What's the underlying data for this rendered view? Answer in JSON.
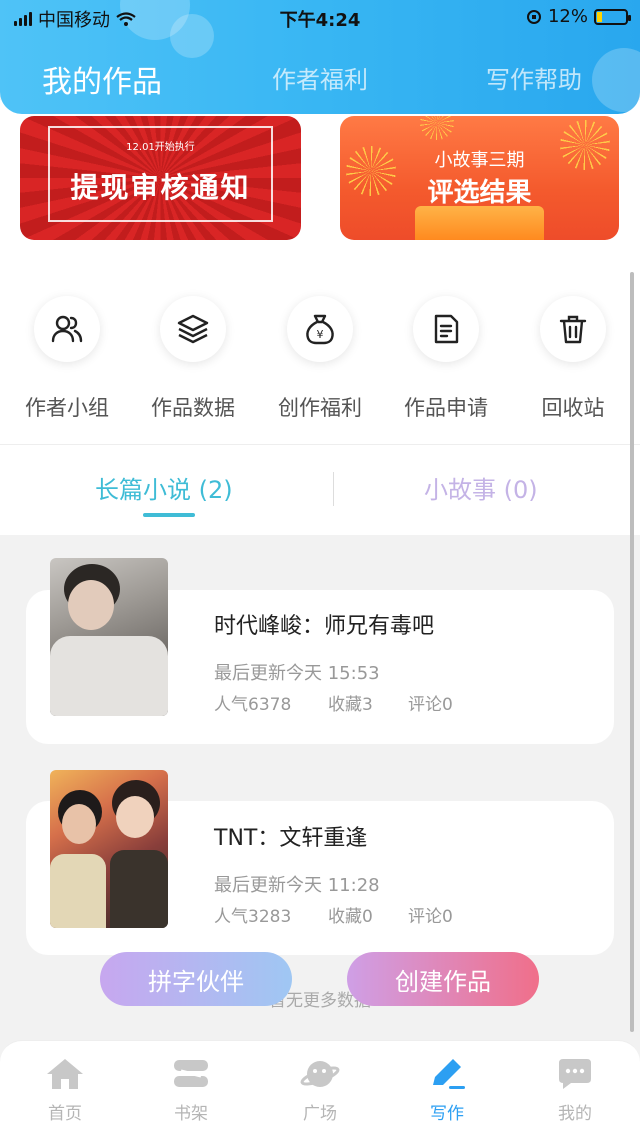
{
  "status_bar": {
    "carrier": "中国移动",
    "time": "下午4:24",
    "battery": "12%"
  },
  "header": {
    "tabs": [
      {
        "label": "我的作品",
        "active": true
      },
      {
        "label": "作者福利",
        "active": false
      },
      {
        "label": "写作帮助",
        "active": false
      }
    ]
  },
  "banners": [
    {
      "small": "12.01开始执行",
      "title": "提现审核通知"
    },
    {
      "line1": "小故事三期",
      "line2": "评选结果"
    }
  ],
  "quick_actions": [
    {
      "label": "作者小组",
      "icon": "group-icon"
    },
    {
      "label": "作品数据",
      "icon": "layers-icon"
    },
    {
      "label": "创作福利",
      "icon": "money-bag-icon"
    },
    {
      "label": "作品申请",
      "icon": "document-icon"
    },
    {
      "label": "回收站",
      "icon": "trash-icon"
    }
  ],
  "segment_tabs": [
    {
      "label": "长篇小说 (2)",
      "active": true
    },
    {
      "label": "小故事 (0)",
      "active": false
    }
  ],
  "works": [
    {
      "title": "时代峰峻：师兄有毒吧",
      "updated": "最后更新今天 15:53",
      "popularity": "人气6378",
      "favorites": "收藏3",
      "comments": "评论0"
    },
    {
      "title": "TNT：文轩重逢",
      "updated": "最后更新今天 11:28",
      "popularity": "人气3283",
      "favorites": "收藏0",
      "comments": "评论0"
    }
  ],
  "no_more_text": "暂无更多数据",
  "floating_buttons": {
    "partner": "拼字伙伴",
    "create": "创建作品"
  },
  "bottom_nav": [
    {
      "label": "首页",
      "icon": "home-icon",
      "active": false
    },
    {
      "label": "书架",
      "icon": "bookshelf-icon",
      "active": false
    },
    {
      "label": "广场",
      "icon": "planet-icon",
      "active": false
    },
    {
      "label": "写作",
      "icon": "pen-icon",
      "active": true
    },
    {
      "label": "我的",
      "icon": "chat-icon",
      "active": false
    }
  ],
  "colors": {
    "header_blue": "#38b6f3",
    "accent_teal": "#3fbcd6",
    "nav_active": "#2c9ff2"
  }
}
